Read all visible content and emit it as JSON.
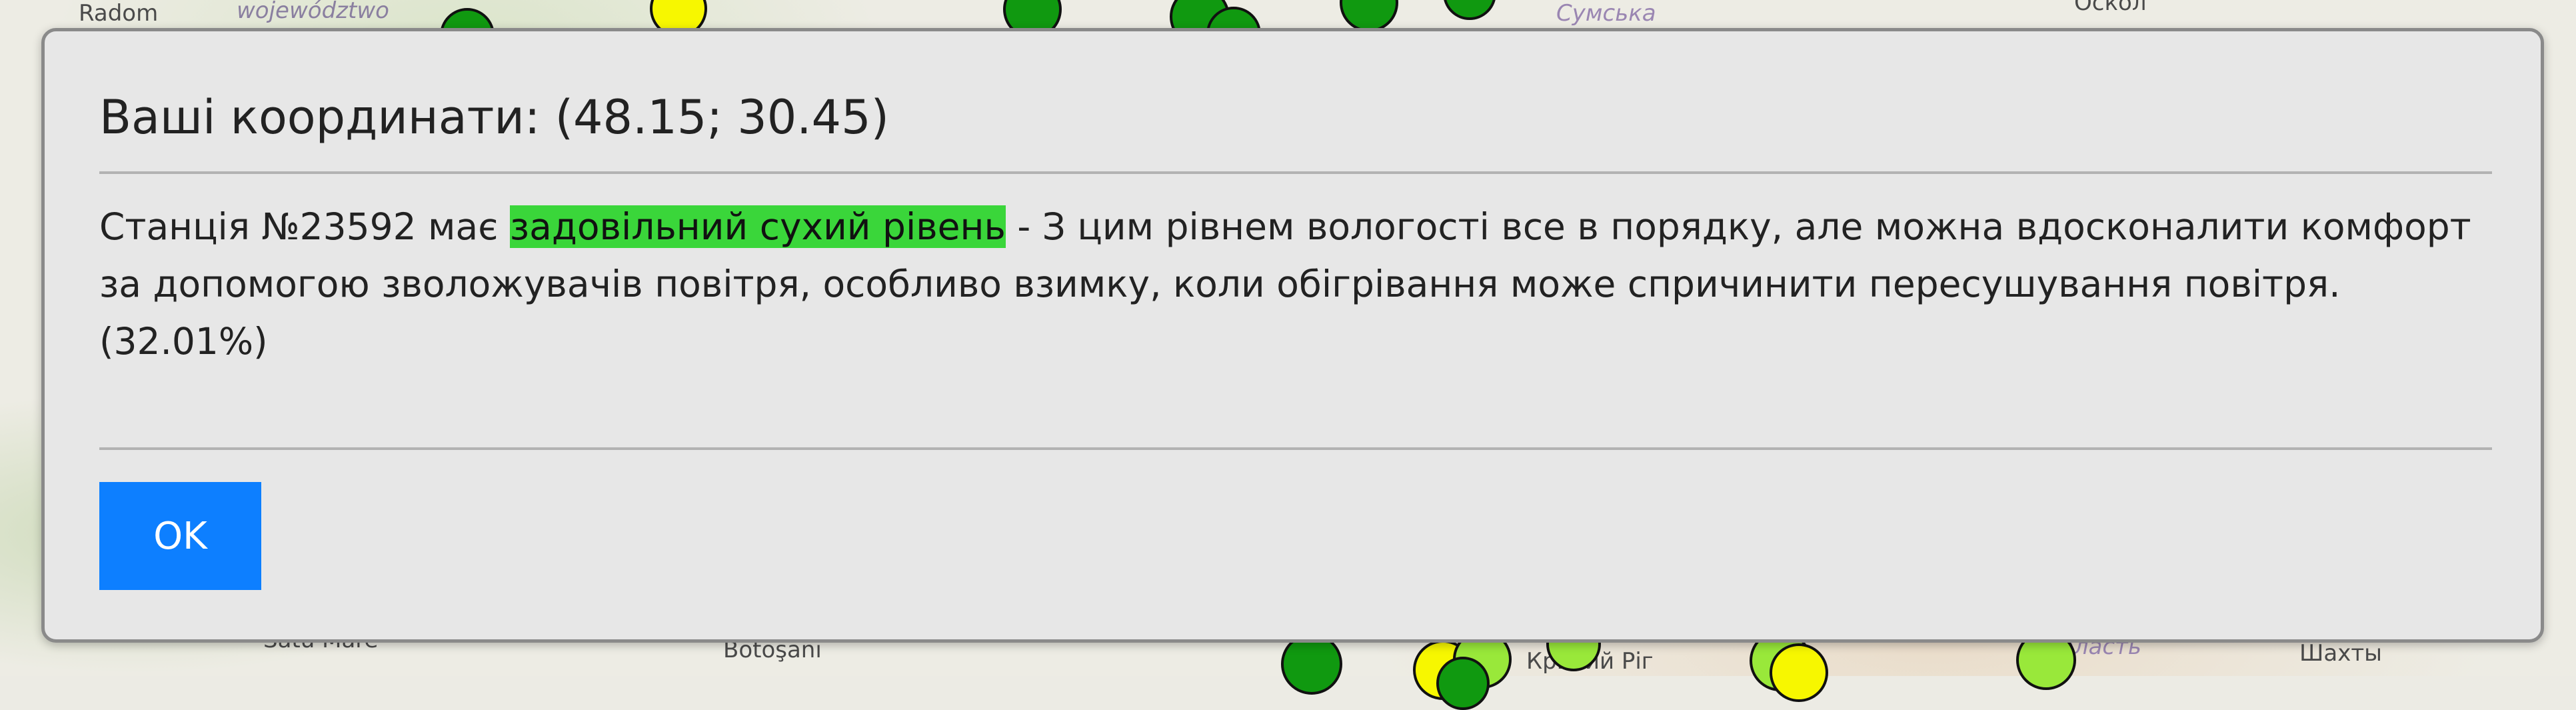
{
  "map": {
    "labels": {
      "radom": "Radom",
      "wojewodztwo": "województwo",
      "sumska": "Сумська",
      "oskol": "Оскол",
      "satu_mare": "Satu Mare",
      "botosani": "Botoşani",
      "kryvyi_rih": "Кривий Ріг",
      "shakhty": "Шахты",
      "oblast": "область"
    },
    "station_colors": {
      "dark_green": "#109910",
      "light_green": "#99e83a",
      "yellow": "#f7f700"
    }
  },
  "modal": {
    "title": "Ваші координати: (48.15; 30.45)",
    "body": {
      "prefix": "Станція №23592 має ",
      "highlight": "задовільний сухий рівень",
      "rest": " - З цим рівнем вологості все в порядку, але можна вдосконалити комфорт за допомогою зволожувачів повітря, особливо взимку, коли обігрівання може спричинити пересушування повітря.",
      "percent": "(32.01%)"
    },
    "highlight_color": "#3ad63a",
    "ok_label": "OK",
    "ok_color": "#0d7fff"
  }
}
